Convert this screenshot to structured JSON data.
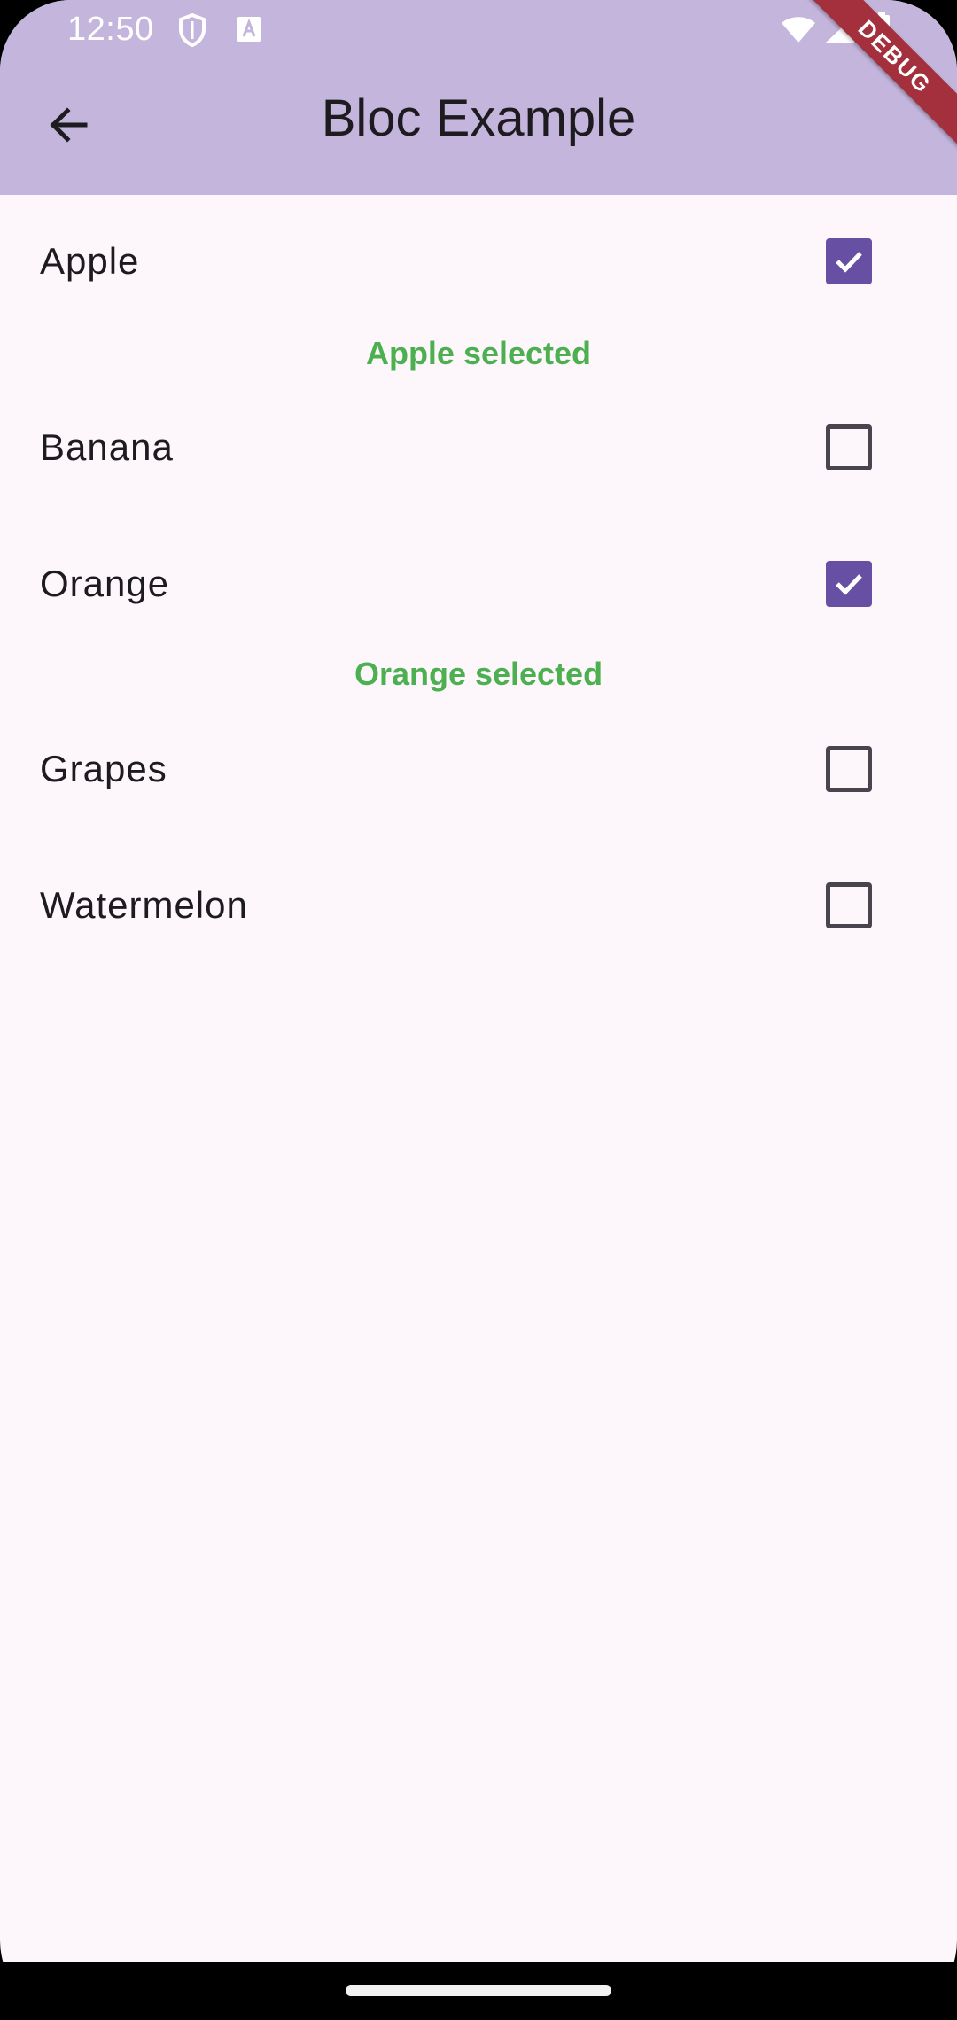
{
  "status_bar": {
    "time": "12:50",
    "icons": [
      "shield-icon",
      "text-a-icon",
      "wifi-icon",
      "signal-icon",
      "battery-icon"
    ]
  },
  "debug_banner": "DEBUG",
  "app_bar": {
    "title": "Bloc Example",
    "back_icon": "arrow-left-icon",
    "background": "#c3b5db"
  },
  "items": [
    {
      "label": "Apple",
      "checked": true,
      "selected_text": "Apple selected"
    },
    {
      "label": "Banana",
      "checked": false,
      "selected_text": ""
    },
    {
      "label": "Orange",
      "checked": true,
      "selected_text": "Orange selected"
    },
    {
      "label": "Grapes",
      "checked": false,
      "selected_text": ""
    },
    {
      "label": "Watermelon",
      "checked": false,
      "selected_text": ""
    }
  ],
  "colors": {
    "accent": "#6750a4",
    "selected_text": "#4caf50",
    "background": "#fdf7fc"
  }
}
